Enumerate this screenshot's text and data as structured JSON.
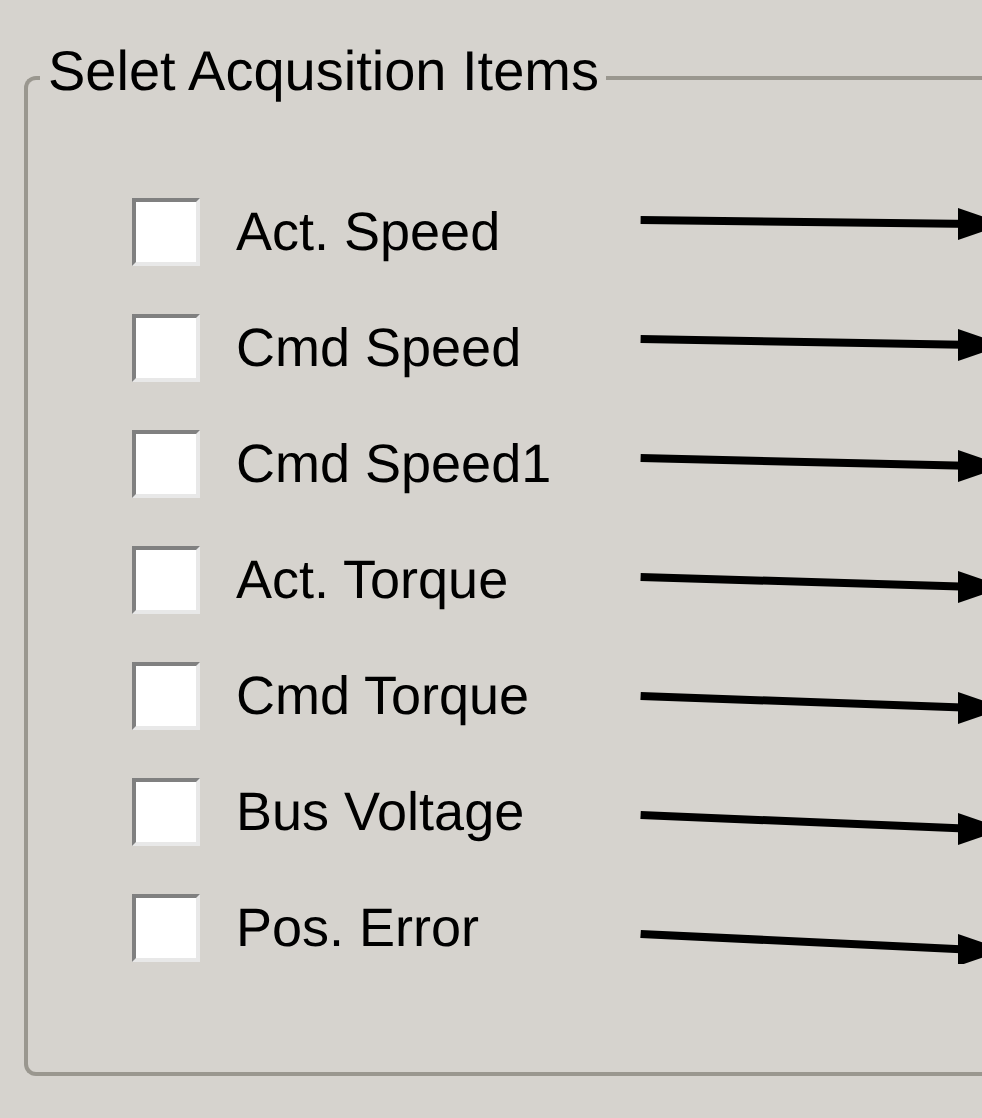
{
  "group": {
    "title": "Selet Acqusition Items"
  },
  "items": [
    {
      "label": "Act. Speed",
      "checked": false
    },
    {
      "label": "Cmd Speed",
      "checked": false
    },
    {
      "label": "Cmd Speed1",
      "checked": false
    },
    {
      "label": "Act. Torque",
      "checked": false
    },
    {
      "label": "Cmd Torque",
      "checked": false
    },
    {
      "label": "Bus Voltage",
      "checked": false
    },
    {
      "label": "Pos. Error",
      "checked": false
    }
  ]
}
